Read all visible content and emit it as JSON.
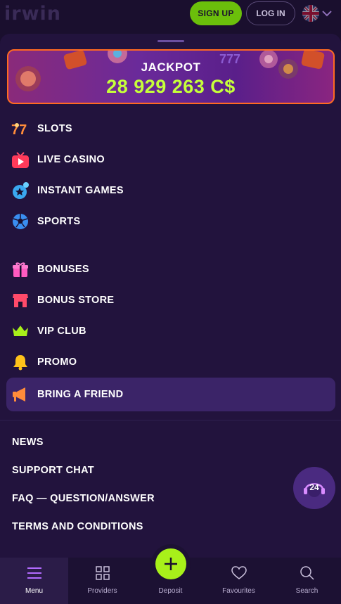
{
  "header": {
    "logo": "irwin",
    "signup_label": "SIGN UP",
    "login_label": "LOG IN",
    "language_icon": "uk-flag-icon"
  },
  "jackpot": {
    "label": "JACKPOT",
    "value": "28 929 263 C$"
  },
  "menu_primary": [
    {
      "label": "SLOTS",
      "icon": "slots-icon"
    },
    {
      "label": "LIVE CASINO",
      "icon": "tv-play-icon"
    },
    {
      "label": "INSTANT GAMES",
      "icon": "instant-games-icon"
    },
    {
      "label": "SPORTS",
      "icon": "soccer-ball-icon"
    }
  ],
  "menu_secondary": [
    {
      "label": "BONUSES",
      "icon": "gift-icon"
    },
    {
      "label": "BONUS STORE",
      "icon": "store-icon"
    },
    {
      "label": "VIP CLUB",
      "icon": "crown-icon"
    },
    {
      "label": "PROMO",
      "icon": "bell-icon"
    },
    {
      "label": "BRING A FRIEND",
      "icon": "megaphone-icon"
    }
  ],
  "links": [
    "NEWS",
    "SUPPORT CHAT",
    "FAQ — QUESTION/ANSWER",
    "TERMS AND CONDITIONS"
  ],
  "support_bubble": {
    "label": "24",
    "icon": "support-headset-icon"
  },
  "bottom_nav": [
    {
      "label": "Menu",
      "icon": "menu-icon"
    },
    {
      "label": "Providers",
      "icon": "grid-icon"
    },
    {
      "label": "Deposit",
      "icon": "plus-icon"
    },
    {
      "label": "Favourites",
      "icon": "heart-icon"
    },
    {
      "label": "Search",
      "icon": "search-icon"
    }
  ],
  "colors": {
    "accent_green": "#a8f01a",
    "background": "#1a0f2e",
    "panel": "#22133d",
    "active_item": "#3b2468",
    "jackpot_border": "#ff6a21"
  }
}
